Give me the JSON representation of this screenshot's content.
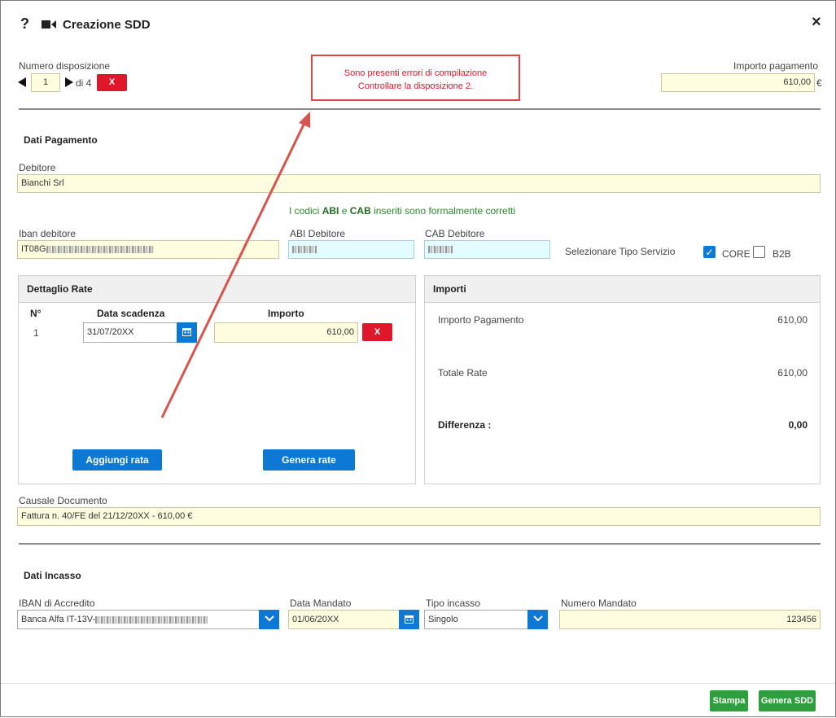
{
  "header": {
    "title": "Creazione SDD",
    "help_glyph": "?",
    "close_glyph": "×"
  },
  "top": {
    "numero_label": "Numero disposizione",
    "current": "1",
    "of_text": "di 4",
    "delete_label": "X",
    "importo_label": "Importo pagamento",
    "importo_value": "610,00",
    "currency": "€"
  },
  "error_box": {
    "line1": "Sono presenti errori di compilazione",
    "line2": "Controllare la disposizione 2."
  },
  "pagamento": {
    "section_title": "Dati Pagamento",
    "debitore_label": "Debitore",
    "debitore_value": "Bianchi Srl",
    "abi_msg_pre": "I codici",
    "abi_word": "ABI",
    "abi_msg_mid": "e",
    "cab_word": "CAB",
    "abi_msg_post": "inseriti sono formalmente corretti",
    "iban_label": "Iban debitore",
    "iban_value_prefix": "IT08G",
    "abi_label": "ABI Debitore",
    "cab_label": "CAB Debitore",
    "tipo_servizio_label": "Selezionare Tipo Servizio",
    "core_label": "CORE",
    "b2b_label": "B2B"
  },
  "rate": {
    "panel_title": "Dettaglio Rate",
    "col_n": "N°",
    "col_data": "Data scadenza",
    "col_importo": "Importo",
    "rows": [
      {
        "n": "1",
        "data": "31/07/20XX",
        "importo": "610,00",
        "delete": "X"
      }
    ],
    "add_label": "Aggiungi rata",
    "generate_label": "Genera rate"
  },
  "importi": {
    "panel_title": "Importi",
    "pagamento_label": "Importo Pagamento",
    "pagamento_value": "610,00",
    "totale_label": "Totale Rate",
    "totale_value": "610,00",
    "differenza_label": "Differenza :",
    "differenza_value": "0,00"
  },
  "causale": {
    "label": "Causale Documento",
    "value": "Fattura n. 40/FE del 21/12/20XX - 610,00 €"
  },
  "incasso": {
    "section_title": "Dati Incasso",
    "iban_label": "IBAN di Accredito",
    "iban_value_prefix": "Banca Alfa IT-13V-",
    "data_label": "Data Mandato",
    "data_value": "01/06/20XX",
    "tipo_label": "Tipo incasso",
    "tipo_value": "Singolo",
    "numero_label": "Numero Mandato",
    "numero_value": "123456"
  },
  "footer": {
    "stampa_label": "Stampa",
    "genera_label": "Genera SDD"
  },
  "colors": {
    "error_red": "#e0162b",
    "primary_blue": "#0e78d5",
    "success_green": "#2e9e3e",
    "field_yellow": "#fffde0",
    "field_cyan": "#e4fbff"
  }
}
